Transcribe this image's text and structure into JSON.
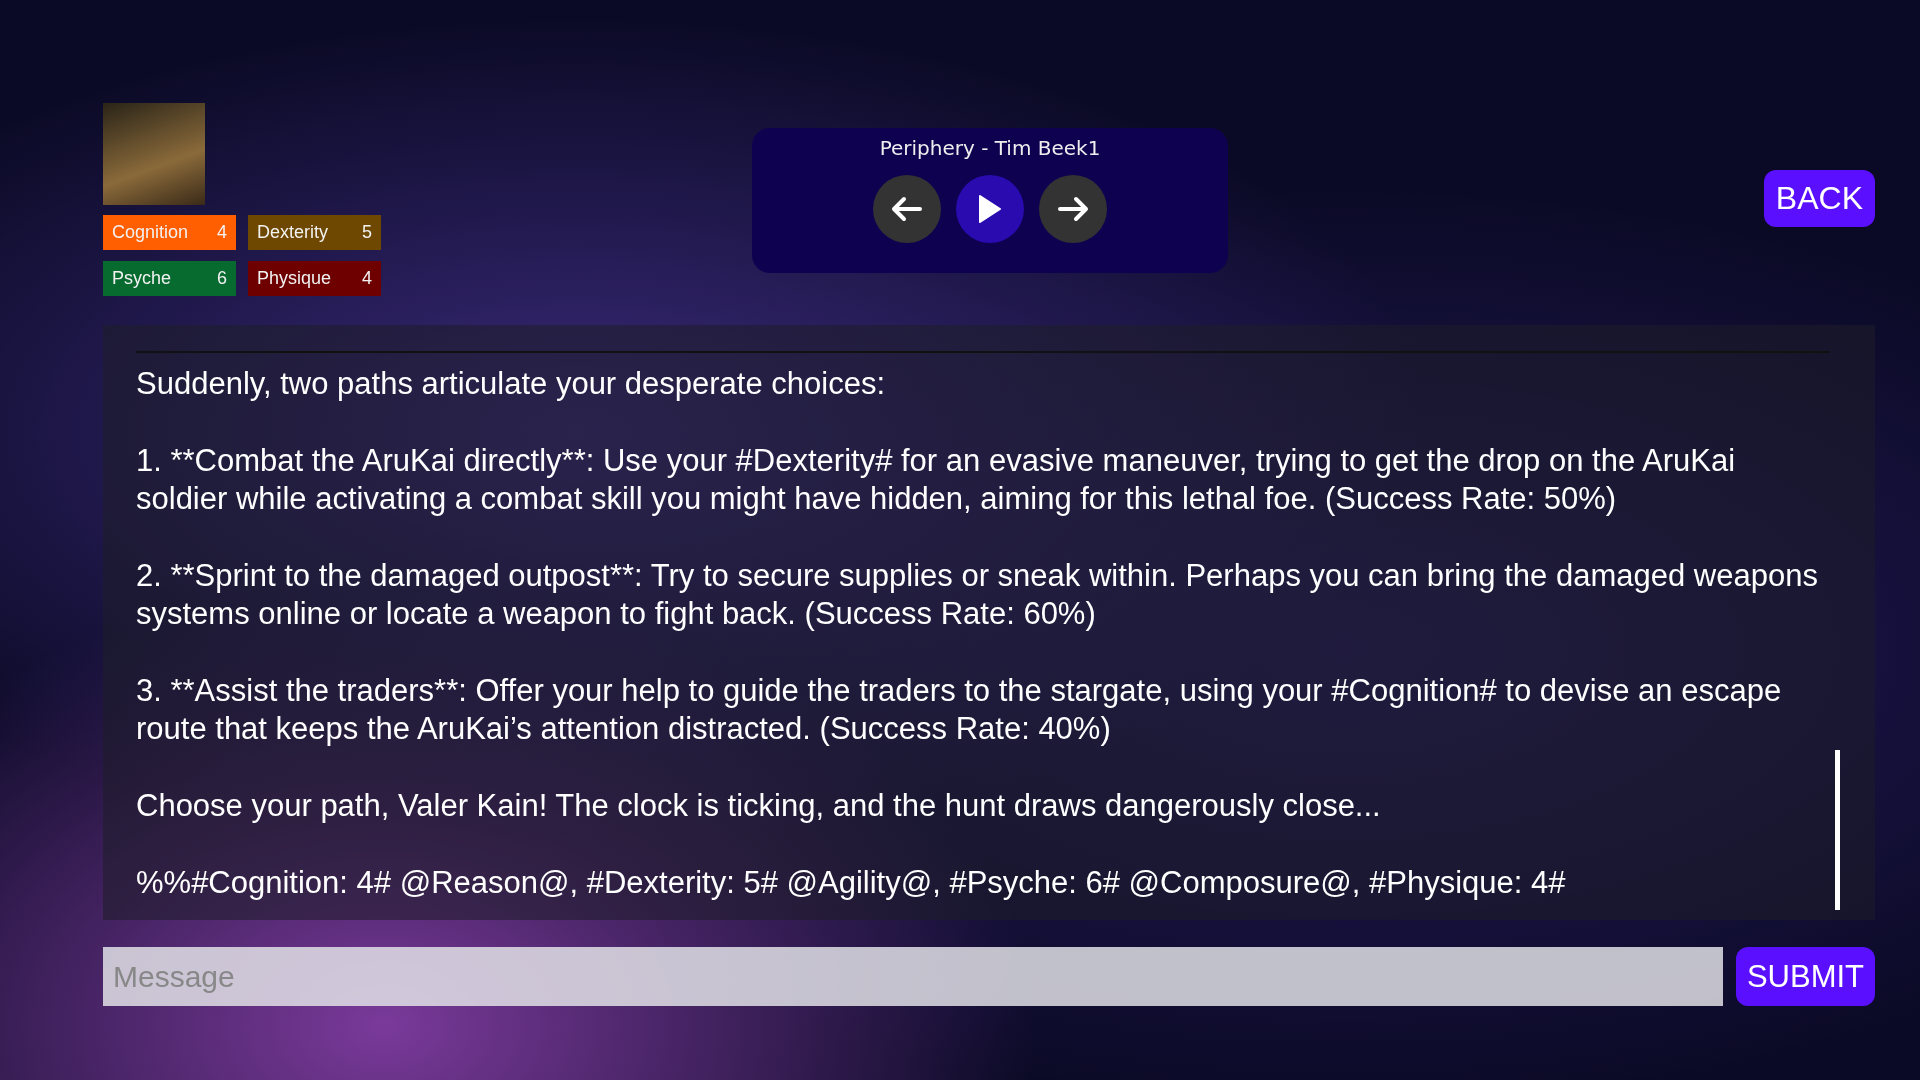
{
  "character": {
    "stats": [
      {
        "name": "Cognition",
        "value": "4",
        "color": "#ff5f00"
      },
      {
        "name": "Dexterity",
        "value": "5",
        "color": "#6e4700"
      },
      {
        "name": "Psyche",
        "value": "6",
        "color": "#076b2f"
      },
      {
        "name": "Physique",
        "value": "4",
        "color": "#6e0000"
      }
    ]
  },
  "player": {
    "track": "Periphery - Tim Beek1"
  },
  "back_button": "BACK",
  "story": {
    "paragraphs": [
      "Suddenly, two paths articulate your desperate choices:",
      "1. **Combat the AruKai directly**: Use your #Dexterity# for an evasive maneuver, trying to get the drop on the AruKai soldier while activating a combat skill you might have hidden, aiming for this lethal foe. (Success Rate: 50%)",
      "2. **Sprint to the damaged outpost**: Try to secure supplies or sneak within. Perhaps you can bring the damaged weapons systems online or locate a weapon to fight back. (Success Rate: 60%)",
      "3. **Assist the traders**: Offer your help to guide the traders to the stargate, using your #Cognition# to devise an escape route that keeps the AruKai’s attention distracted. (Success Rate: 40%)",
      "Choose your path, Valer Kain! The clock is ticking, and the hunt draws dangerously close...",
      "%%#Cognition: 4# @Reason@, #Dexterity: 5# @Agility@, #Psyche: 6# @Composure@, #Physique: 4#"
    ]
  },
  "message": {
    "placeholder": "Message"
  },
  "submit_button": "SUBMIT"
}
